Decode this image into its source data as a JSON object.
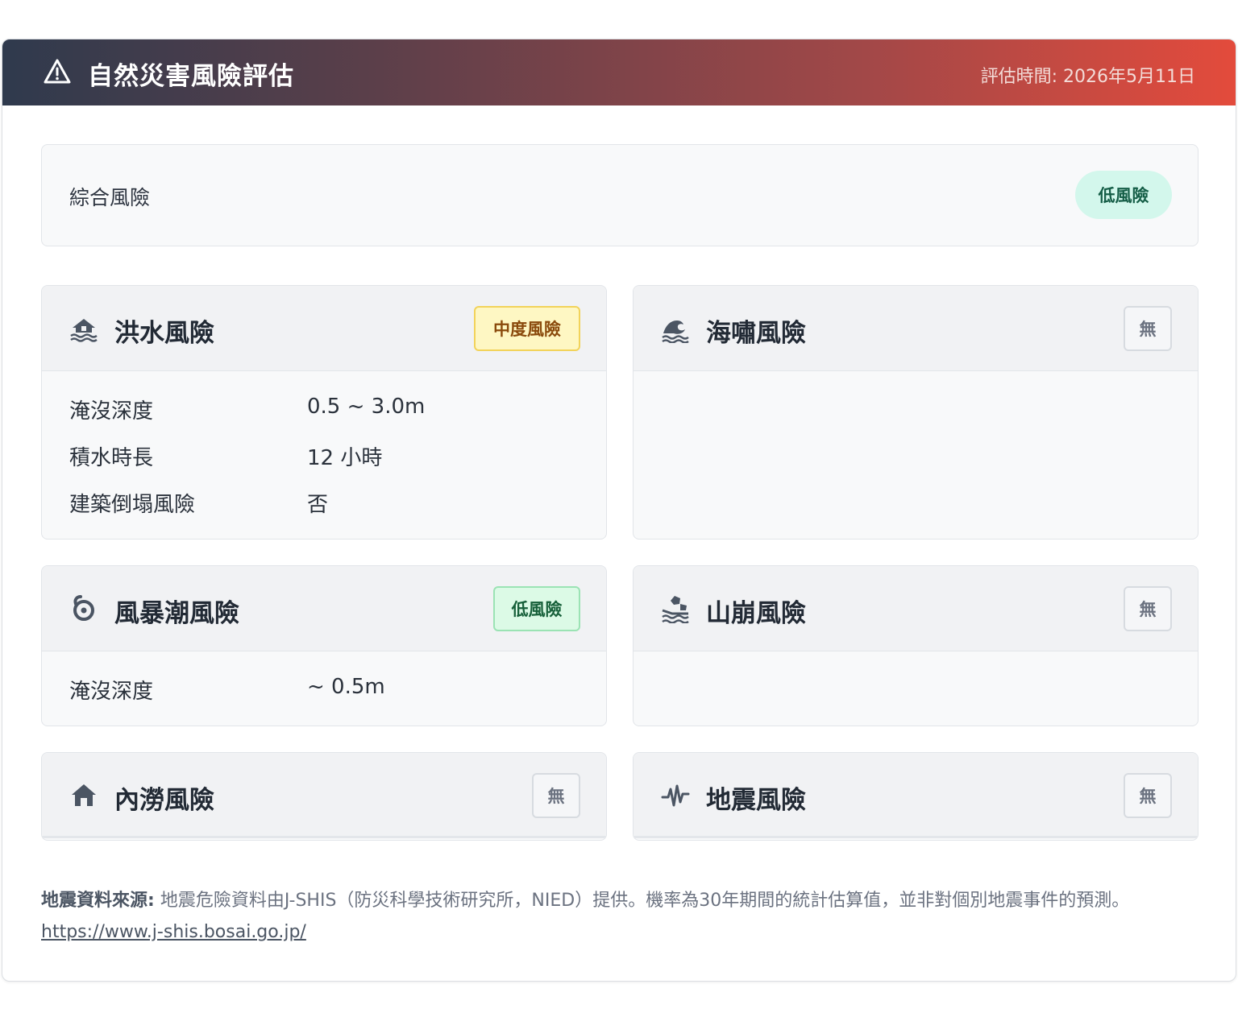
{
  "header": {
    "title": "自然災害風險評估",
    "timestamp": "評估時間: 2026年5月11日",
    "icon": "warning-triangle-icon"
  },
  "overall": {
    "label": "綜合風險",
    "level": "低風險",
    "color": "#d3f7ec"
  },
  "cards": {
    "flood": {
      "icon": "house-flood-icon",
      "name": "洪水風險",
      "badge": "中度風險",
      "rows": [
        {
          "key": "淹沒深度",
          "value": "0.5 ~ 3.0m"
        },
        {
          "key": "積水時長",
          "value": "12 小時"
        },
        {
          "key": "建築倒塌風險",
          "value": "否"
        }
      ]
    },
    "tsunami": {
      "icon": "water-wave-icon",
      "name": "海嘯風險",
      "badge": "無"
    },
    "storm_surge": {
      "icon": "hurricane-icon",
      "name": "風暴潮風險",
      "badge": "低風險",
      "rows": [
        {
          "key": "淹沒深度",
          "value": "~ 0.5m"
        }
      ]
    },
    "landslide": {
      "icon": "landslide-icon",
      "name": "山崩風險",
      "badge": "無"
    },
    "inland_flood": {
      "icon": "house-icon",
      "name": "內澇風險",
      "badge": "無"
    },
    "earthquake": {
      "icon": "seismic-wave-icon",
      "name": "地震風險",
      "badge": "無"
    }
  },
  "footer": {
    "source_label": "地震資料來源:",
    "source_text": "地震危險資料由J-SHIS（防災科學技術研究所，NIED）提供。機率為30年期間的統計估算值，並非對個別地震事件的預測。",
    "link": "https://www.j-shis.bosai.go.jp/"
  },
  "colors": {
    "header_start": "#2f3a4d",
    "header_end": "#e34b3c",
    "mid_risk": "#fef7c3",
    "low_risk": "#dcfae6"
  }
}
